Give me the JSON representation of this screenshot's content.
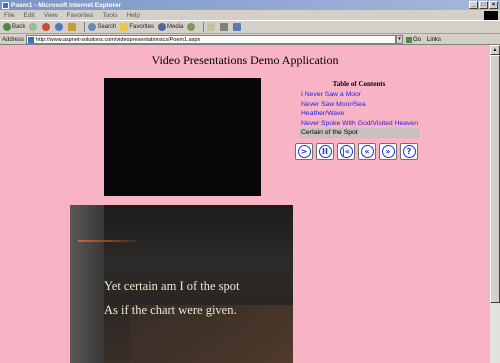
{
  "window": {
    "title": "Poem1 - Microsoft Internet Explorer"
  },
  "menu": [
    "File",
    "Edit",
    "View",
    "Favorites",
    "Tools",
    "Help"
  ],
  "toolbar": {
    "back": "Back",
    "search": "Search",
    "favorites": "Favorites",
    "media": "Media"
  },
  "address": {
    "label": "Address",
    "url": "http://www.aspnet-solutions.com/videopresentationscs/Poem1.aspx",
    "go": "Go",
    "links": "Links"
  },
  "page": {
    "title": "Video Presentations Demo Application",
    "toc_title": "Table of Contents",
    "toc_items": [
      "I Never Saw a Moor",
      "Never Saw Moor/Sea",
      "Heather/Wave",
      "Never Spoke With God/Visited Heaven",
      "Certain of the Spot"
    ],
    "selected_index": 4,
    "controls": [
      {
        "name": "play",
        "glyph": ">"
      },
      {
        "name": "pause",
        "glyph": "II"
      },
      {
        "name": "first",
        "glyph": "|«"
      },
      {
        "name": "previous",
        "glyph": "«"
      },
      {
        "name": "next",
        "glyph": "»"
      },
      {
        "name": "help",
        "glyph": "?"
      }
    ],
    "video_lines": [
      "Yet certain am I of the spot",
      "As if the chart were given."
    ]
  },
  "colors": {
    "page_background": "#f8b4c4",
    "link": "#2222dd",
    "selected_item": "#c8c0c0"
  }
}
